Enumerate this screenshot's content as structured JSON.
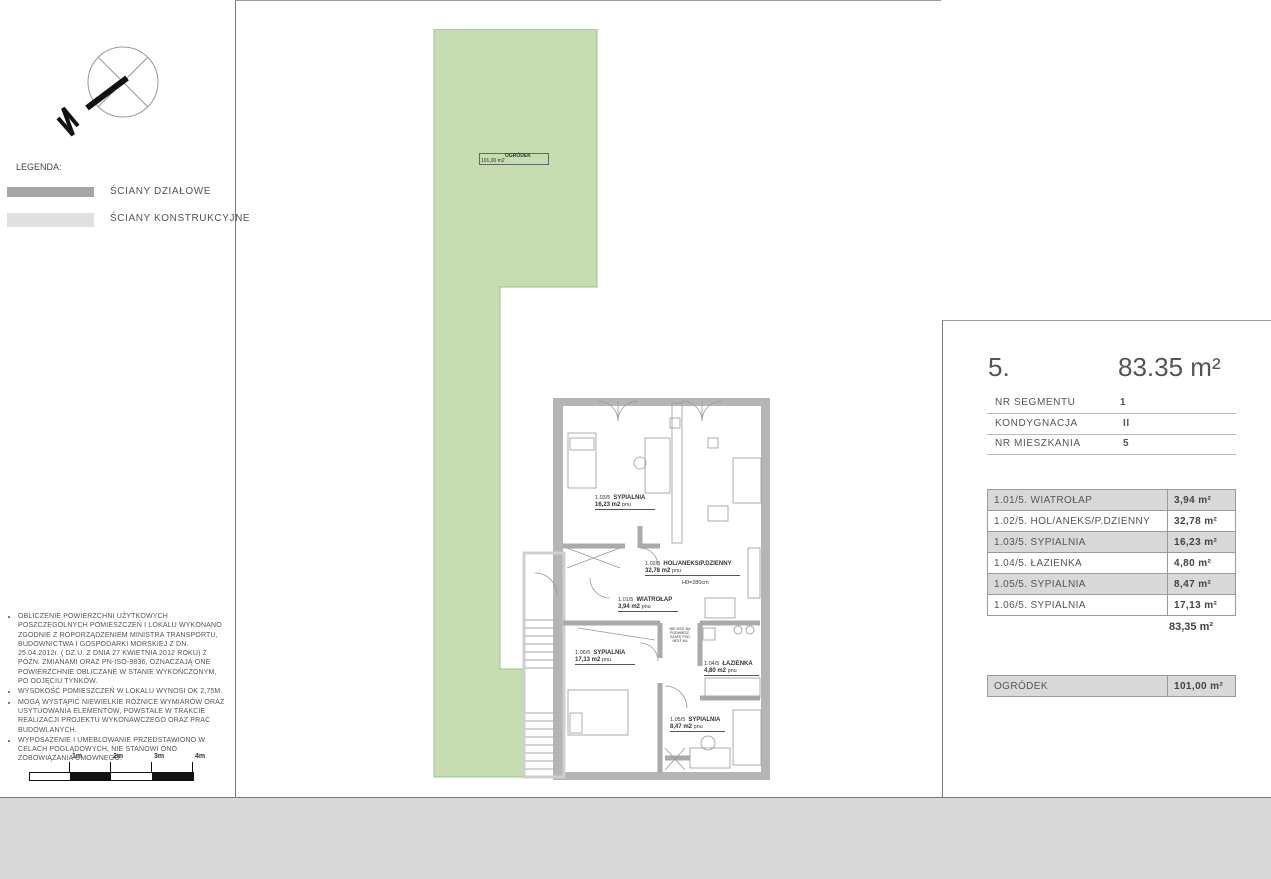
{
  "legend": {
    "title": "LEGENDA:",
    "items": [
      {
        "label": "ŚCIANY DZIAŁOWE",
        "color": "#a6a6a6"
      },
      {
        "label": "ŚCIANY KONSTRUKCYJNE",
        "color": "#e0e0e0"
      }
    ]
  },
  "notes": [
    "OBLICZENIE POWIERZCHNI UŻYTKOWYCH POSZCZEGÓLNYCH POMIESZCZEŃ I LOKALU WYKONANO ZGODNIE Z ROPORZĄDZENIEM MINISTRA TRANSPORTU, BUDOWNICTWA I GOSPODARKI MORSKIEJ Z DN. 25.04.2012r. ( DZ.U. Z DNIA 27 KWIETNIA 2012 ROKU) Z PÓŹN. ZMIANAMI ORAZ PN-ISO-9836, OZNACZAJĄ ONE POWIERZCHNIE OBLICZANE W STANIE WYKOŃCZONYM, PO ODJĘCIU TYNKÓW.",
    "WYSOKOŚĆ POMIESZCZEŃ W LOKALU WYNOSI OK 2,75M.",
    "MOGĄ WYSTĄPIĆ NIEWIELKIE RÓŻNICE WYMIARÓW ORAZ USYTUOWANIA ELEMENTÓW, POWSTAŁE W TRAKCIE REALIZACJI PROJEKTU WYKONAWCZEGO ORAZ PRAC BUDOWLANYCH.",
    "WYPOSAŻENIE I UMEBLOWANIE PRZEDSTAWIONO W CELACH POGLĄDOWYCH, NIE STANOWI ONO ZOBOWIĄZANIA UMOWNEGO."
  ],
  "scale_labels": [
    "1m",
    "2m",
    "3m",
    "4m"
  ],
  "plan": {
    "garden_label": "OGRÓDEK",
    "garden_area": "101,00 m2",
    "garden_color": "#c5ddb0",
    "height_label": "H0=280cm",
    "rooms": [
      {
        "code": "1.03/5",
        "name": "SYPIALNIA",
        "area": "16,23 m2",
        "unit": "pnu"
      },
      {
        "code": "1.02/5",
        "name": "HOL/ANEKS/P.DZIENNY",
        "area": "32,78 m2",
        "unit": "pnu"
      },
      {
        "code": "1.01/5",
        "name": "WIATROŁAP",
        "area": "3,94 m2",
        "unit": "pnu"
      },
      {
        "code": "1.06/5",
        "name": "SYPIALNIA",
        "area": "17,13 m2",
        "unit": "pnu"
      },
      {
        "code": "1.04/5",
        "name": "ŁAZIENKA",
        "area": "4,80 m2",
        "unit": "pnu"
      },
      {
        "code": "1.05/5",
        "name": "SYPIALNIA",
        "area": "8,47 m2",
        "unit": "pnu"
      }
    ],
    "note_small": "MIEJSCE NA PODWIESZ. SZAFĘ POD NEXT NA"
  },
  "summary": {
    "unit_no": "5.",
    "area": "83.35 m²",
    "info": [
      {
        "label": "NR SEGMENTU",
        "value": "1"
      },
      {
        "label": "KONDYGNACJA",
        "value": "II"
      },
      {
        "label": "NR MIESZKANIA",
        "value": "5"
      }
    ],
    "rooms": [
      {
        "name": "1.01/5. WIATROŁAP",
        "area": "3,94 m²"
      },
      {
        "name": "1.02/5. HOL/ANEKS/P.DZIENNY",
        "area": "32,78 m²"
      },
      {
        "name": "1.03/5. SYPIALNIA",
        "area": "16,23 m²"
      },
      {
        "name": "1.04/5. ŁAZIENKA",
        "area": "4,80 m²"
      },
      {
        "name": "1.05/5. SYPIALNIA",
        "area": "8,47 m²"
      },
      {
        "name": "1.06/5. SYPIALNIA",
        "area": "17,13 m²"
      }
    ],
    "total": "83,35 m²",
    "garden": {
      "name": "OGRÓDEK",
      "area": "101,00 m²"
    }
  }
}
